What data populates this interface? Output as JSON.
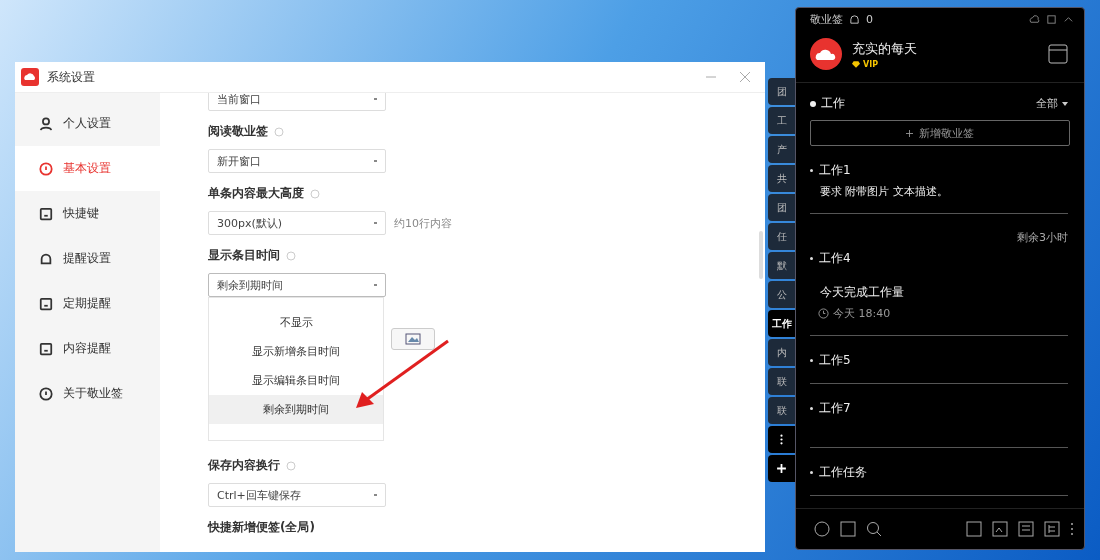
{
  "settings_window": {
    "title": "系统设置",
    "sidebar": [
      {
        "label": "个人设置",
        "selected": false
      },
      {
        "label": "基本设置",
        "selected": true
      },
      {
        "label": "快捷键",
        "selected": false
      },
      {
        "label": "提醒设置",
        "selected": false
      },
      {
        "label": "定期提醒",
        "selected": false
      },
      {
        "label": "内容提醒",
        "selected": false
      },
      {
        "label": "关于敬业签",
        "selected": false
      }
    ],
    "groups": [
      {
        "value": "当前窗口",
        "expanded": false
      },
      {
        "label": "阅读敬业签",
        "value": "新开窗口",
        "expanded": false
      },
      {
        "label": "单条内容最大高度",
        "value": "300px(默认)",
        "note": "约10行内容",
        "expanded": false
      },
      {
        "label": "显示条目时间",
        "value": "剩余到期时间",
        "expanded": true,
        "options": [
          {
            "label": "不显示",
            "selected": false
          },
          {
            "label": "显示新增条目时间",
            "selected": false
          },
          {
            "label": "显示编辑条目时间",
            "selected": false
          },
          {
            "label": "剩余到期时间",
            "selected": true
          }
        ]
      },
      {
        "label": "保存内容换行",
        "value": "Ctrl+回车键保存",
        "expanded": false
      },
      {
        "label": "快捷新增便签(全局)"
      }
    ]
  },
  "side_tabs": [
    {
      "label": "团",
      "selected": false
    },
    {
      "label": "工",
      "selected": false
    },
    {
      "label": "产",
      "selected": false
    },
    {
      "label": "共",
      "selected": false
    },
    {
      "label": "团",
      "selected": false
    },
    {
      "label": "任",
      "selected": false
    },
    {
      "label": "默",
      "selected": false
    },
    {
      "label": "公",
      "selected": false
    },
    {
      "label": "工作",
      "selected": true
    },
    {
      "label": "内",
      "selected": false
    },
    {
      "label": "联",
      "selected": false
    },
    {
      "label": "联",
      "selected": false
    }
  ],
  "panel": {
    "title": "敬业签",
    "notice_count": "0",
    "user": "充实的每天",
    "badge": "VIP",
    "category": "工作",
    "filter": "全部",
    "add_placeholder": "新增敬业签",
    "notes": [
      {
        "title": "工作1",
        "body": "要求 附带图片 文本描述。"
      },
      {
        "remaining": "剩余3小时",
        "title": "工作4",
        "body": "今天完成工作量",
        "time": "今天 18:40"
      },
      {
        "title": "工作5"
      },
      {
        "title": "工作7"
      },
      {
        "title": "工作任务"
      }
    ]
  }
}
